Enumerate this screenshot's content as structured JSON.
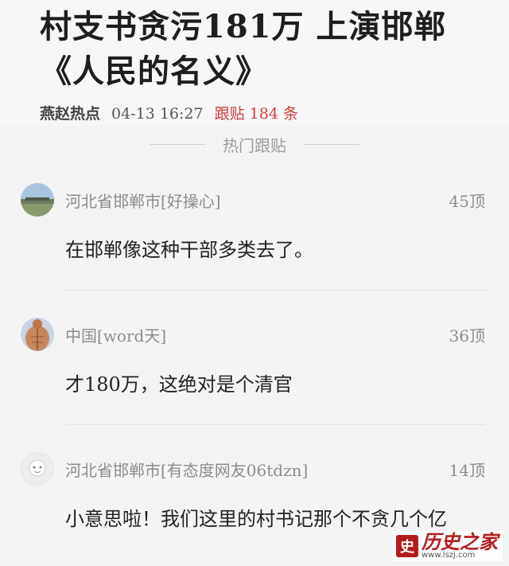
{
  "article": {
    "title_line1": "村支书贪污181万 上演邯郸",
    "title_line2": "《人民的名义》",
    "source": "燕赵热点",
    "time": "04-13 16:27",
    "reply_label": "跟贴",
    "reply_count": "184",
    "reply_unit": "条"
  },
  "section": {
    "title": "热门跟贴"
  },
  "comments": [
    {
      "user": "河北省邯郸市[好操心]",
      "votes": "45顶",
      "text": "在邯郸像这种干部多类去了。",
      "avatar": "landscape-avatar"
    },
    {
      "user": "中国[word天]",
      "votes": "36顶",
      "text": "才180万，这绝对是个清官",
      "avatar": "muscle-avatar"
    },
    {
      "user": "河北省邯郸市[有态度网友06tdzn]",
      "votes": "14顶",
      "text": "小意思啦！我们这里的村书记那个不贪几个亿",
      "avatar": "default-avatar"
    }
  ],
  "watermark": {
    "seal": "史",
    "name": "历史之家",
    "url": "www.lszj.com"
  }
}
